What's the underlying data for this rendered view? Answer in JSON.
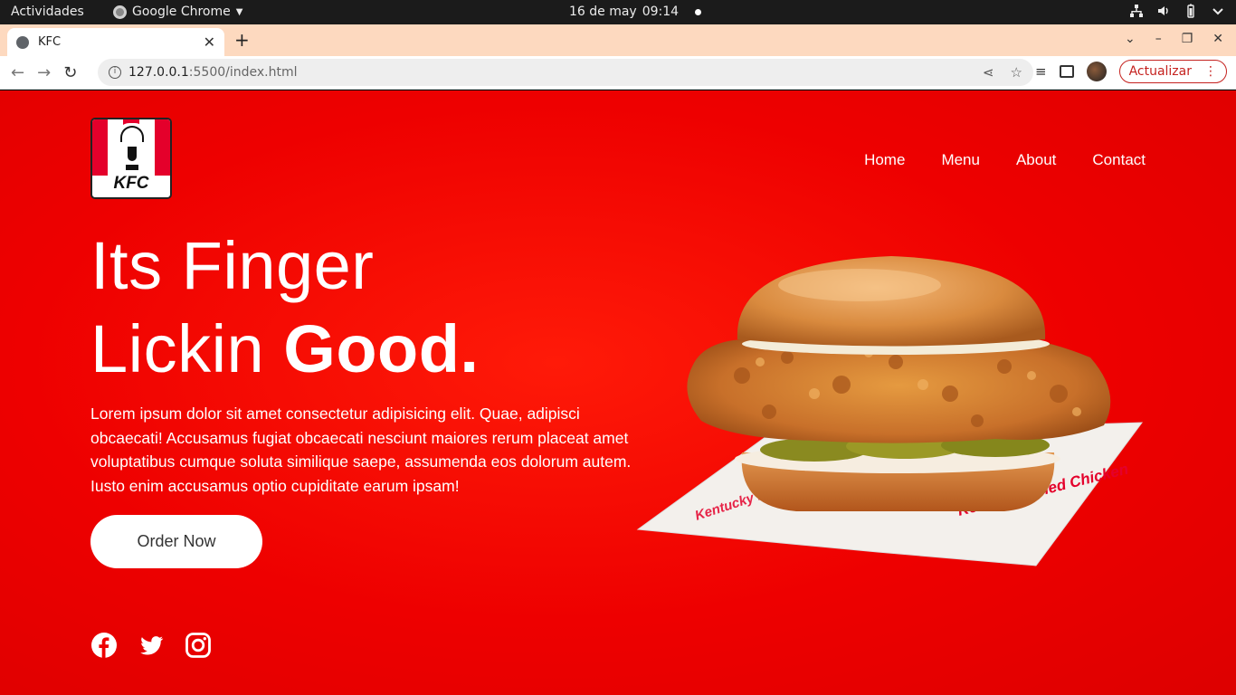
{
  "system": {
    "activities": "Actividades",
    "app_name": "Google Chrome",
    "date": "16 de may",
    "time": "09:14"
  },
  "browser": {
    "tab_title": "KFC",
    "url_host": "127.0.0.1",
    "url_path": ":5500/index.html",
    "update_label": "Actualizar"
  },
  "site": {
    "brand": "KFC",
    "nav": [
      "Home",
      "Menu",
      "About",
      "Contact"
    ],
    "headline_line1": "Its Finger",
    "headline_line2": "Lickin",
    "headline_bold": "Good.",
    "paragraph": "Lorem ipsum dolor sit amet consectetur adipisicing elit. Quae, adipisci obcaecati! Accusamus fugiat obcaecati nesciunt maiores rerum placeat amet voluptatibus cumque soluta similique saepe, assumenda eos dolorum autem. Iusto enim accusamus optio cupiditate earum ipsam!",
    "cta": "Order Now",
    "social": [
      "facebook-icon",
      "twitter-icon",
      "instagram-icon"
    ],
    "wrapper_print": "Kentucky Fried Chicken",
    "colors": {
      "primary": "#ee0000",
      "brand_red": "#e4002b"
    }
  }
}
